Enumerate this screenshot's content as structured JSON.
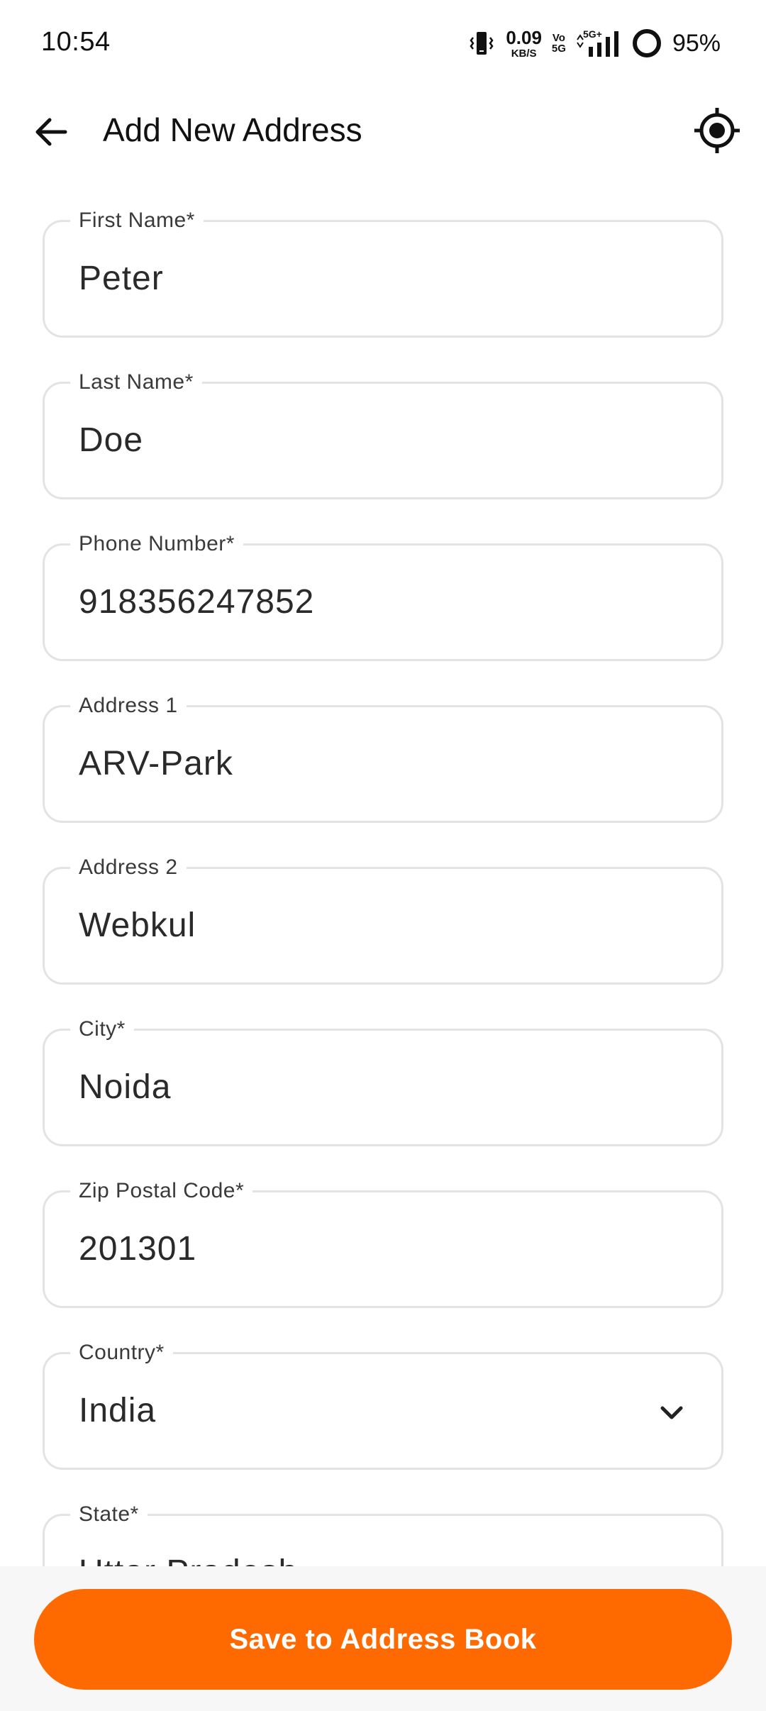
{
  "status_bar": {
    "time": "10:54",
    "net_speed_value": "0.09",
    "net_speed_unit": "KB/S",
    "volte_top": "Vo",
    "volte_bottom": "5G",
    "network_type": "5G+",
    "battery": "95%"
  },
  "app_bar": {
    "title": "Add New Address",
    "back_icon": "arrow-left-icon",
    "locate_icon": "gps-locate-icon"
  },
  "form": {
    "fields": [
      {
        "label": "First Name*",
        "value": "Peter"
      },
      {
        "label": "Last Name*",
        "value": "Doe"
      },
      {
        "label": "Phone Number*",
        "value": "918356247852"
      },
      {
        "label": "Address 1",
        "value": "ARV-Park"
      },
      {
        "label": "Address 2",
        "value": "Webkul"
      },
      {
        "label": "City*",
        "value": "Noida"
      },
      {
        "label": "Zip Postal Code*",
        "value": "201301"
      },
      {
        "label": "Country*",
        "value": "India"
      },
      {
        "label": "State*",
        "value": "Uttar Pradesh"
      }
    ]
  },
  "actions": {
    "save_label": "Save to Address Book"
  },
  "colors": {
    "accent": "#ff6a00",
    "border": "#e3e3e3",
    "bottom_bar": "#f7f7f7"
  }
}
